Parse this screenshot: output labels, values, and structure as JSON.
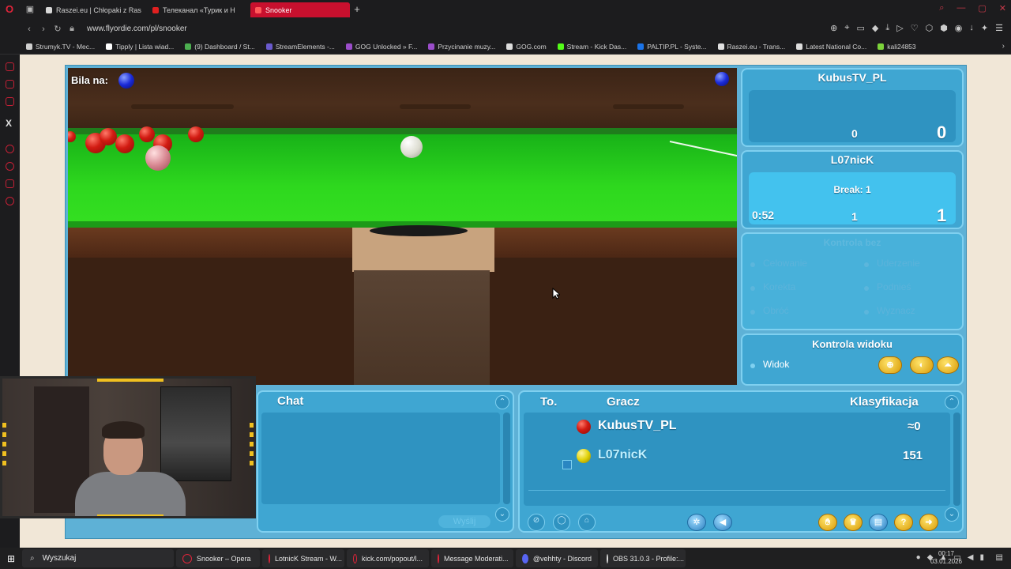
{
  "browser": {
    "tabs": [
      {
        "label": "Raszei.eu | Chłopaki z Ras",
        "color": "#d8d8d8",
        "active": false
      },
      {
        "label": "Телеканал «Турик и Н",
        "color": "#e02020",
        "active": false
      },
      {
        "label": "Snooker",
        "color": "#e02020",
        "active": true
      }
    ],
    "url": "www.flyordie.com/pl/snooker",
    "bookmarks": [
      {
        "label": "Strumyk.TV - Mec...",
        "color": "#cfcfcf"
      },
      {
        "label": "Tipply | Lista wiad...",
        "color": "#ffffff"
      },
      {
        "label": "(9) Dashboard / St...",
        "color": "#4caf50"
      },
      {
        "label": "StreamElements -...",
        "color": "#6a5acd"
      },
      {
        "label": "GOG Unlocked » F...",
        "color": "#9b4dca"
      },
      {
        "label": "Przycinanie muzy...",
        "color": "#9b4dca"
      },
      {
        "label": "GOG.com",
        "color": "#dddddd"
      },
      {
        "label": "Stream - Kick Das...",
        "color": "#53fc18"
      },
      {
        "label": "PALTIP.PL - Syste...",
        "color": "#1a73e8"
      },
      {
        "label": "Raszei.eu - Trans...",
        "color": "#e0e0e0"
      },
      {
        "label": "Latest National Co...",
        "color": "#dddddd"
      },
      {
        "label": "kali24853",
        "color": "#7cd33a"
      }
    ]
  },
  "game": {
    "bila_label": "Bila na:",
    "player1": {
      "name": "KubusTV_PL",
      "score_left": "0",
      "score_right": "0"
    },
    "player2": {
      "name": "L07nicK",
      "break": "Break: 1",
      "timer": "0:52",
      "score_left": "1",
      "score_right": "1"
    },
    "controls": {
      "title": "Kontrola bez",
      "options": [
        "Celowanie",
        "Uderzenie",
        "Korekta",
        "Podnieś",
        "Obróć",
        "Wyznacz"
      ]
    },
    "view": {
      "title": "Kontrola widoku",
      "option": "Widok"
    },
    "chat": {
      "title": "Chat",
      "send": "Wyślij"
    },
    "players_table": {
      "headers": [
        "To.",
        "Gracz",
        "Klasyfikacja"
      ],
      "rows": [
        {
          "ball_color": "#d21b12",
          "name": "KubusTV_PL",
          "rating": "≈0"
        },
        {
          "ball_color": "#e2d20a",
          "name": "L07nicK",
          "rating": "151"
        }
      ]
    }
  },
  "taskbar": {
    "search_placeholder": "Wyszukaj",
    "apps": [
      "Snooker – Opera",
      "LotnicK Stream - W...",
      "kick.com/popout/l...",
      "Message Moderati...",
      "@vehhty - Discord",
      "OBS 31.0.3 - Profile:..."
    ],
    "time": "00:17",
    "date": "03.01.2026"
  }
}
